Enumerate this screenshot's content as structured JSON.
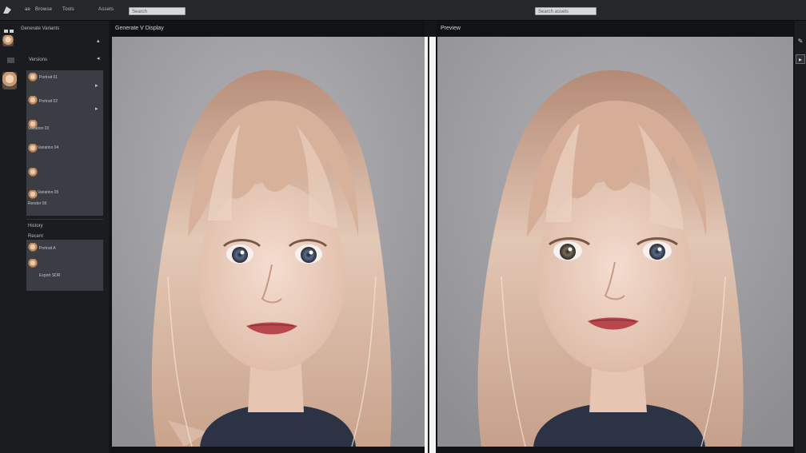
{
  "menu": {
    "items": [
      "ae",
      "Browse",
      "Tools",
      "Assets"
    ]
  },
  "search_left": {
    "placeholder": "Search"
  },
  "search_right": {
    "placeholder": "Search assets"
  },
  "sidebar": {
    "header_title": "Generate  Variants",
    "section_title": "Versions",
    "items": [
      {
        "label": "Portrait 01"
      },
      {
        "label": "Portrait 02"
      },
      {
        "label": "Variation 03"
      },
      {
        "label": "Variation 04"
      },
      {
        "label": "Variation 05"
      },
      {
        "label": "Render 06"
      }
    ],
    "history_title": "History",
    "history_sub": "Recent",
    "history_items": [
      {
        "label": "Portrait A"
      },
      {
        "label": "Export SDR"
      }
    ]
  },
  "left_view": {
    "title": "Generate V Display"
  },
  "right_view": {
    "title": "Preview"
  },
  "colors": {
    "accent": "#2c2e33",
    "background": "#151619",
    "divider": "#f4f4f4"
  },
  "icons": [
    "app-logo-icon",
    "chevron-up-icon",
    "chevron-right-icon",
    "wrench-icon",
    "expand-icon"
  ]
}
